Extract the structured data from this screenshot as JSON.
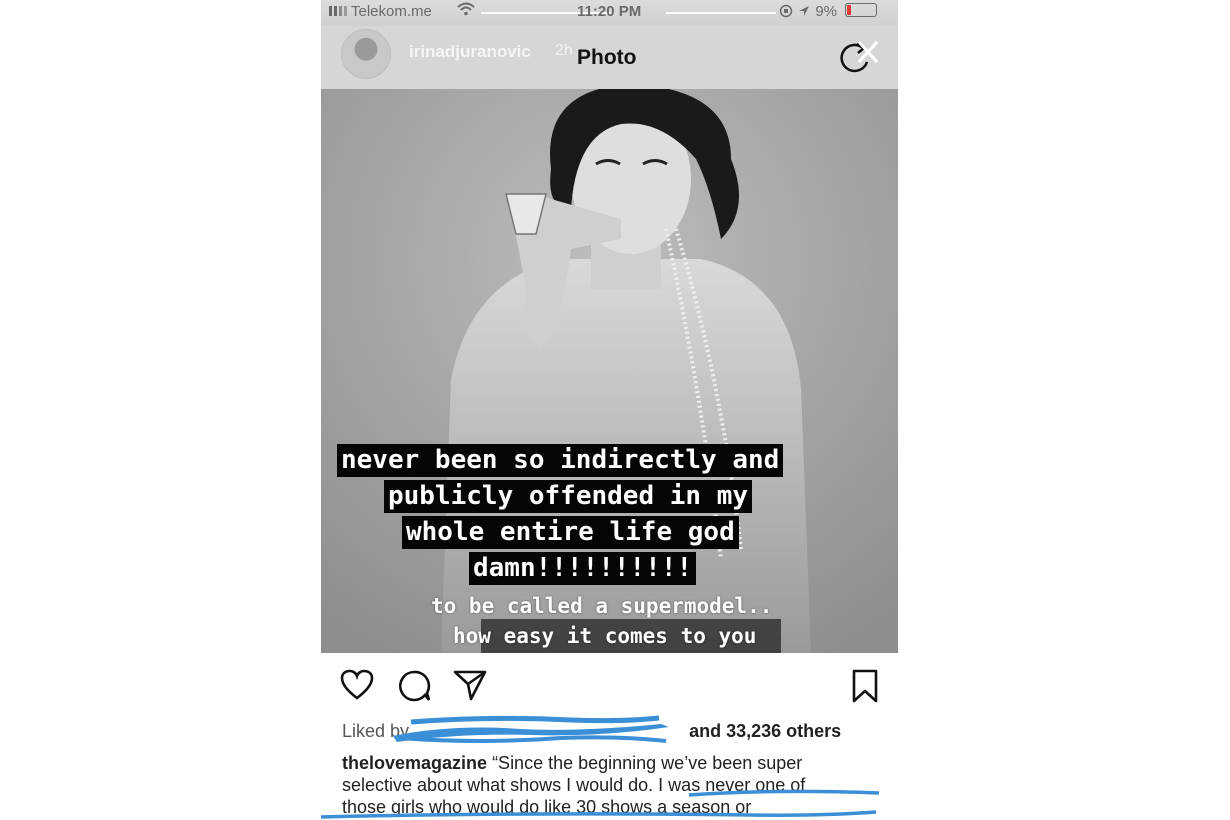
{
  "status_bar": {
    "carrier": "Telekom.me",
    "time": "11:20 PM",
    "battery": "9%",
    "icons": [
      "signal-icon",
      "wifi-icon",
      "lock-rotation-icon",
      "location-icon",
      "battery-icon"
    ]
  },
  "story_header": {
    "username": "irinadjuranovic",
    "time_ago": "2h",
    "title": "Photo",
    "icons": [
      "rotate-icon",
      "close-icon"
    ]
  },
  "story_text": {
    "highlighted_lines": [
      "never been so indirectly and",
      "publicly offended in my",
      "whole entire life god",
      "damn!!!!!!!!!!"
    ],
    "plain_lines": [
      "to be called a supermodel..",
      "how easy it comes to you"
    ]
  },
  "post": {
    "icons": [
      "heart-icon",
      "comment-icon",
      "share-icon",
      "bookmark-icon"
    ],
    "liked_prefix": "Liked by",
    "liked_suffix": "and 33,236 others",
    "caption_user": "thelovemagazine",
    "caption_lines": [
      "“Since the beginning we’ve been super",
      "selective about what shows I would do. I was never one of",
      "those girls who would do like 30 shows a season or"
    ]
  },
  "colors": {
    "accent_scribble": "#3a8fd6",
    "battery_low": "#e53935"
  }
}
